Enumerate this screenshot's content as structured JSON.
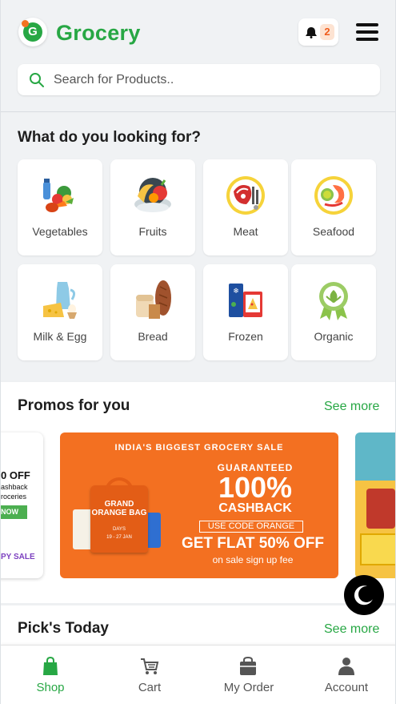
{
  "header": {
    "logo_letter": "G",
    "brand": "Grocery",
    "notification_count": "2",
    "search_placeholder": "Search for Products.."
  },
  "categories": {
    "title": "What do you looking for?",
    "items": [
      {
        "label": "Vegetables",
        "icon": "vegetables-icon"
      },
      {
        "label": "Fruits",
        "icon": "fruits-icon"
      },
      {
        "label": "Meat",
        "icon": "meat-icon"
      },
      {
        "label": "Seafood",
        "icon": "seafood-icon"
      },
      {
        "label": "Milk & Egg",
        "icon": "milk-egg-icon"
      },
      {
        "label": "Bread",
        "icon": "bread-icon"
      },
      {
        "label": "Frozen",
        "icon": "frozen-icon"
      },
      {
        "label": "Organic",
        "icon": "organic-icon"
      }
    ]
  },
  "promos": {
    "title": "Promos for you",
    "see_more": "See more",
    "left_banner": {
      "line1": "0 OFF",
      "line2": "ashback",
      "line3": "roceries",
      "button": "NOW",
      "brand": "PY SALE"
    },
    "main_banner": {
      "headline": "INDIA'S BIGGEST GROCERY SALE",
      "guaranteed": "GUARANTEED",
      "percent": "100%",
      "cashback": "CASHBACK",
      "code": "USE CODE ORANGE",
      "offer": "GET FLAT 50% OFF",
      "subtext": "on sale sign up fee",
      "bag_title": "GRAND ORANGE BAG",
      "bag_days": "DAYS",
      "bag_dates": "19 - 27 JAN"
    }
  },
  "picks": {
    "title": "Pick's Today",
    "see_more": "See more"
  },
  "bottom_nav": {
    "items": [
      {
        "label": "Shop",
        "active": true
      },
      {
        "label": "Cart",
        "active": false
      },
      {
        "label": "My Order",
        "active": false
      },
      {
        "label": "Account",
        "active": false
      }
    ]
  },
  "colors": {
    "brand_green": "#27a744",
    "promo_orange": "#f37021",
    "badge_orange": "#f05c1c"
  }
}
